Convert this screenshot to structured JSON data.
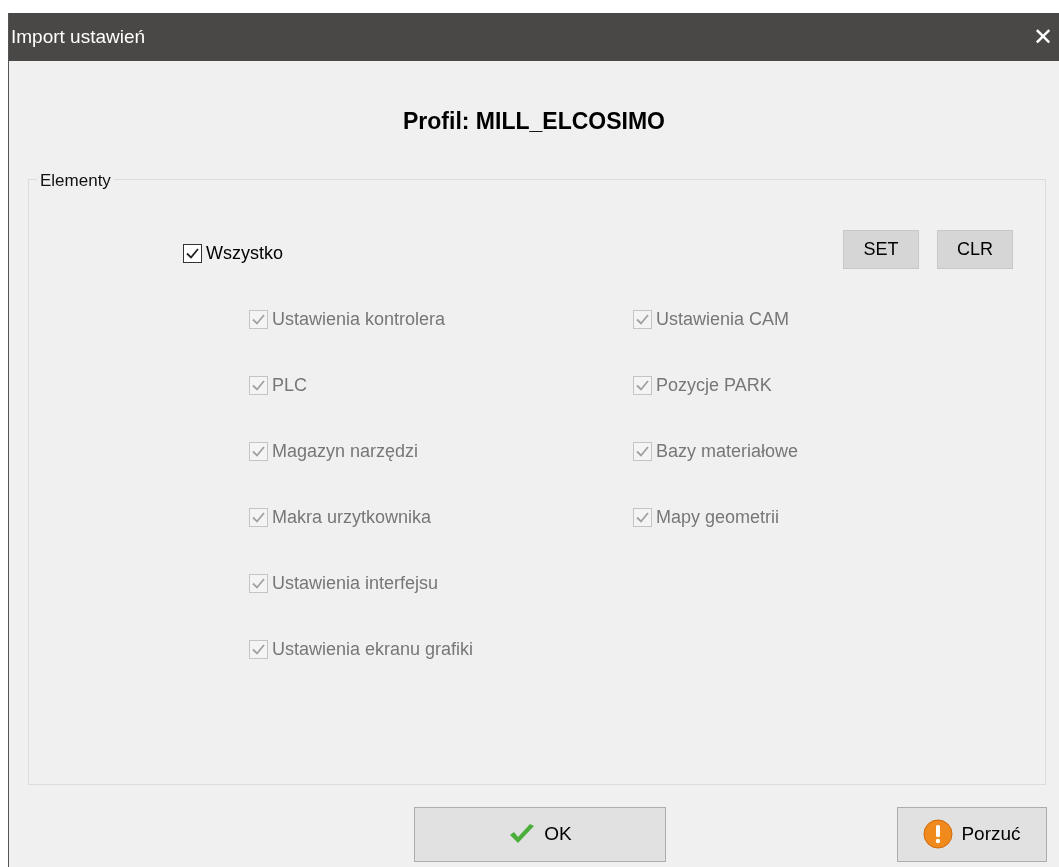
{
  "window": {
    "title": "Import ustawień",
    "close": "✕"
  },
  "heading": "Profil: MILL_ELCOSIMO",
  "group": {
    "legend": "Elementy",
    "master": {
      "label": "Wszystko",
      "checked": true,
      "disabled": false
    },
    "buttons": [
      "SET",
      "CLR"
    ],
    "columns": [
      [
        {
          "label": "Ustawienia kontrolera",
          "checked": true,
          "disabled": true
        },
        {
          "label": "PLC",
          "checked": true,
          "disabled": true
        },
        {
          "label": "Magazyn narzędzi",
          "checked": true,
          "disabled": true
        },
        {
          "label": "Makra urzytkownika",
          "checked": true,
          "disabled": true
        },
        {
          "label": "Ustawienia interfejsu",
          "checked": true,
          "disabled": true
        },
        {
          "label": "Ustawienia ekranu grafiki",
          "checked": true,
          "disabled": true
        }
      ],
      [
        {
          "label": "Ustawienia CAM",
          "checked": true,
          "disabled": true
        },
        {
          "label": "Pozycje PARK",
          "checked": true,
          "disabled": true
        },
        {
          "label": "Bazy materiałowe",
          "checked": true,
          "disabled": true
        },
        {
          "label": "Mapy geometrii",
          "checked": true,
          "disabled": true
        }
      ]
    ]
  },
  "footer": [
    {
      "kind": "ok",
      "label": "OK"
    },
    {
      "kind": "cancel",
      "label": "Porzuć"
    }
  ]
}
